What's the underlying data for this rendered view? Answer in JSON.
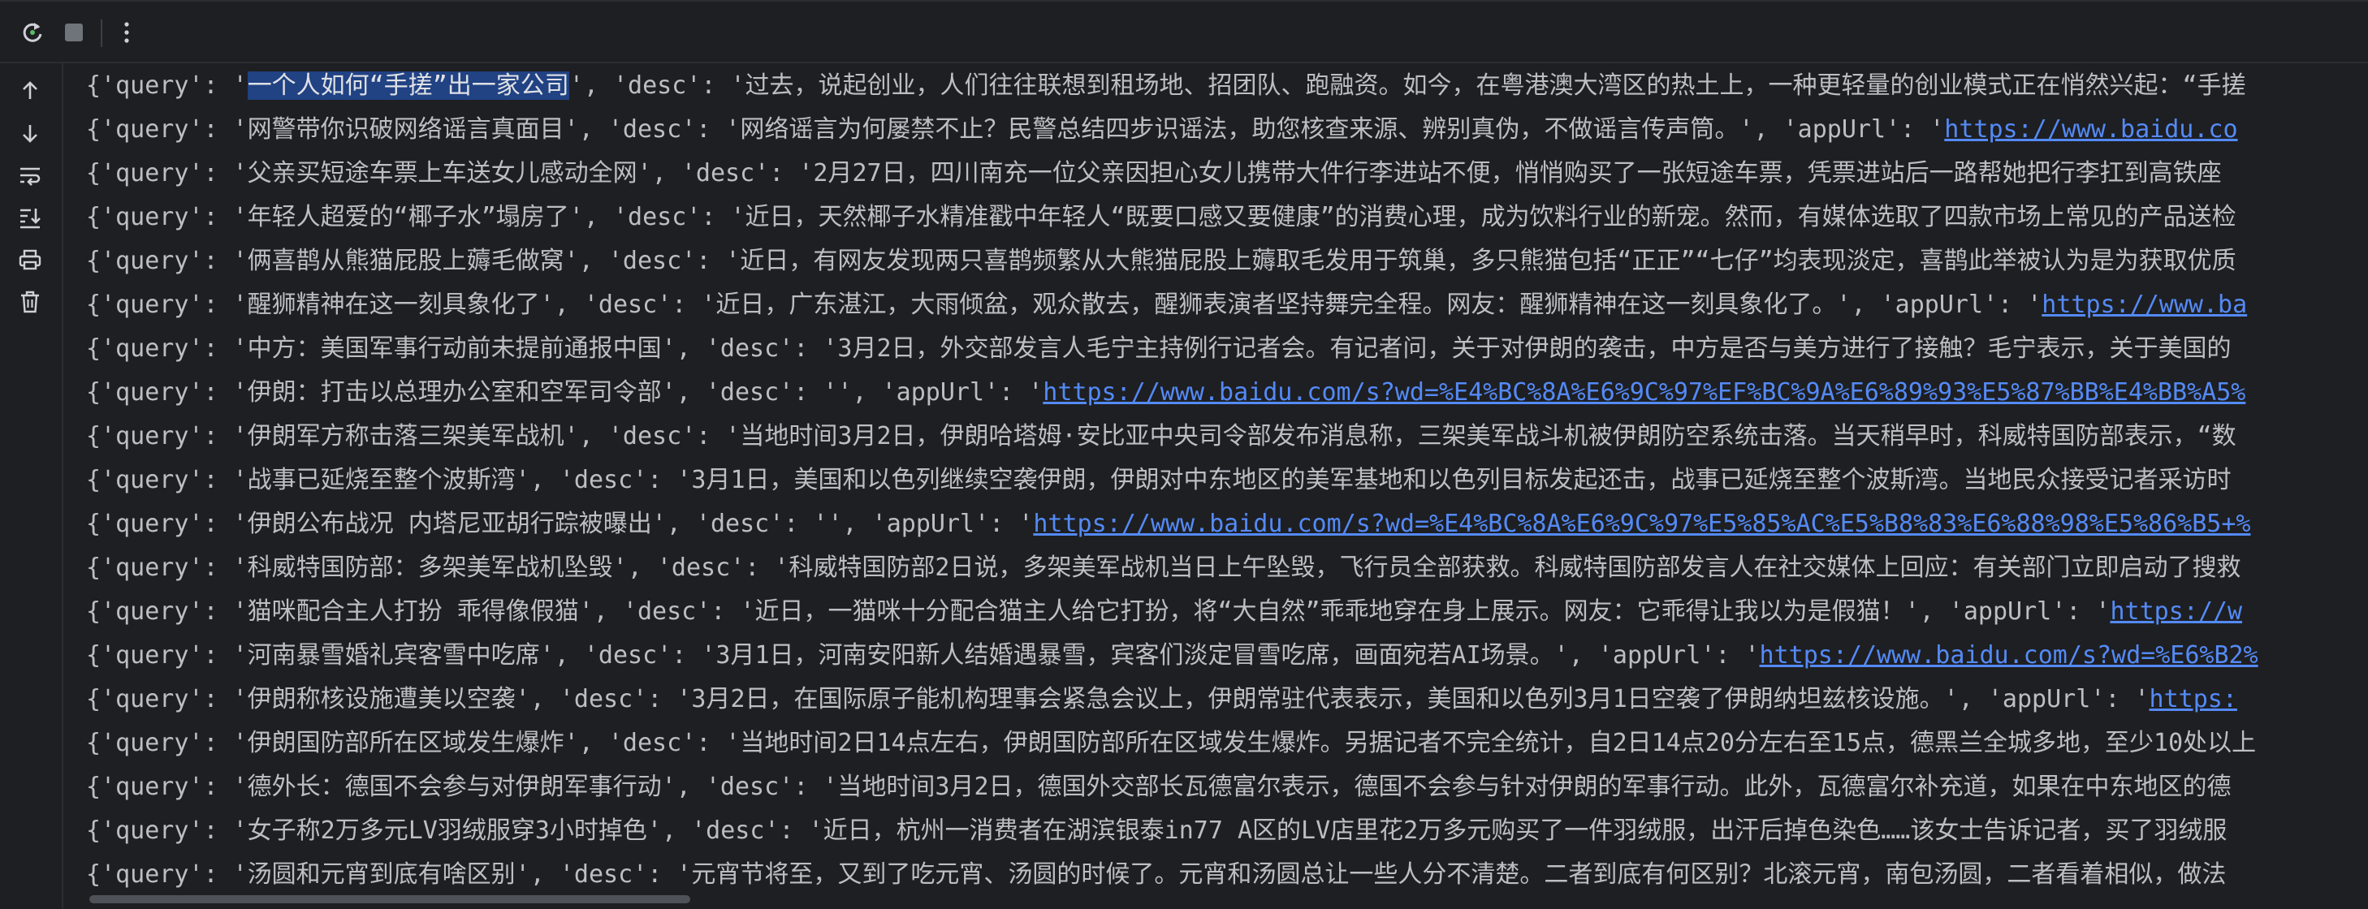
{
  "toolbar": {
    "rerun_icon": "rerun-icon",
    "stop_icon": "stop-icon",
    "more_icon": "more-vertical-icon"
  },
  "gutter": {
    "icons": [
      "arrow-up-icon",
      "arrow-down-icon",
      "soft-wrap-icon",
      "scroll-to-end-icon",
      "print-icon",
      "trash-icon"
    ]
  },
  "console": {
    "lines": [
      {
        "pre": "{'query': '",
        "sel": "一个人如何“手搓”出一家公司",
        "post": "', 'desc': '过去，说起创业，人们往往联想到租场地、招团队、跑融资。如今，在粤港澳大湾区的热土上，一种更轻量的创业模式正在悄然兴起：“手搓",
        "url": ""
      },
      {
        "pre": "{'query': '网警带你识破网络谣言真面目', 'desc': '网络谣言为何屡禁不止？民警总结四步识谣法，助您核查来源、辨别真伪，不做谣言传声筒。', 'appUrl': '",
        "sel": "",
        "post": "",
        "url": "https://www.baidu.co"
      },
      {
        "pre": "{'query': '父亲买短途车票上车送女儿感动全网', 'desc': '2月27日，四川南充一位父亲因担心女儿携带大件行李进站不便，悄悄购买了一张短途车票，凭票进站后一路帮她把行李扛到高铁座",
        "sel": "",
        "post": "",
        "url": ""
      },
      {
        "pre": "{'query': '年轻人超爱的“椰子水”塌房了', 'desc': '近日，天然椰子水精准戳中年轻人“既要口感又要健康”的消费心理，成为饮料行业的新宠。然而，有媒体选取了四款市场上常见的产品送检",
        "sel": "",
        "post": "",
        "url": ""
      },
      {
        "pre": "{'query': '俩喜鹊从熊猫屁股上薅毛做窝', 'desc': '近日，有网友发现两只喜鹊频繁从大熊猫屁股上薅取毛发用于筑巢，多只熊猫包括“正正”“七仔”均表现淡定，喜鹊此举被认为是为获取优质",
        "sel": "",
        "post": "",
        "url": ""
      },
      {
        "pre": "{'query': '醒狮精神在这一刻具象化了', 'desc': '近日，广东湛江，大雨倾盆，观众散去，醒狮表演者坚持舞完全程。网友：醒狮精神在这一刻具象化了。', 'appUrl': '",
        "sel": "",
        "post": "",
        "url": "https://www.ba"
      },
      {
        "pre": "{'query': '中方：美国军事行动前未提前通报中国', 'desc': '3月2日，外交部发言人毛宁主持例行记者会。有记者问，关于对伊朗的袭击，中方是否与美方进行了接触？毛宁表示，关于美国的",
        "sel": "",
        "post": "",
        "url": ""
      },
      {
        "pre": "{'query': '伊朗：打击以总理办公室和空军司令部', 'desc': '', 'appUrl': '",
        "sel": "",
        "post": "",
        "url": "https://www.baidu.com/s?wd=%E4%BC%8A%E6%9C%97%EF%BC%9A%E6%89%93%E5%87%BB%E4%BB%A5%"
      },
      {
        "pre": "{'query': '伊朗军方称击落三架美军战机', 'desc': '当地时间3月2日，伊朗哈塔姆·安比亚中央司令部发布消息称，三架美军战斗机被伊朗防空系统击落。当天稍早时，科威特国防部表示，“数",
        "sel": "",
        "post": "",
        "url": ""
      },
      {
        "pre": "{'query': '战事已延烧至整个波斯湾', 'desc': '3月1日，美国和以色列继续空袭伊朗，伊朗对中东地区的美军基地和以色列目标发起还击，战事已延烧至整个波斯湾。当地民众接受记者采访时",
        "sel": "",
        "post": "",
        "url": ""
      },
      {
        "pre": "{'query': '伊朗公布战况 内塔尼亚胡行踪被曝出', 'desc': '', 'appUrl': '",
        "sel": "",
        "post": "",
        "url": "https://www.baidu.com/s?wd=%E4%BC%8A%E6%9C%97%E5%85%AC%E5%B8%83%E6%88%98%E5%86%B5+%"
      },
      {
        "pre": "{'query': '科威特国防部：多架美军战机坠毁', 'desc': '科威特国防部2日说，多架美军战机当日上午坠毁，飞行员全部获救。科威特国防部发言人在社交媒体上回应：有关部门立即启动了搜救",
        "sel": "",
        "post": "",
        "url": ""
      },
      {
        "pre": "{'query': '猫咪配合主人打扮 乖得像假猫', 'desc': '近日，一猫咪十分配合猫主人给它打扮，将“大自然”乖乖地穿在身上展示。网友：它乖得让我以为是假猫！', 'appUrl': '",
        "sel": "",
        "post": "",
        "url": "https://w"
      },
      {
        "pre": "{'query': '河南暴雪婚礼宾客雪中吃席', 'desc': '3月1日，河南安阳新人结婚遇暴雪，宾客们淡定冒雪吃席，画面宛若AI场景。', 'appUrl': '",
        "sel": "",
        "post": "",
        "url": "https://www.baidu.com/s?wd=%E6%B2%"
      },
      {
        "pre": "{'query': '伊朗称核设施遭美以空袭', 'desc': '3月2日，在国际原子能机构理事会紧急会议上，伊朗常驻代表表示，美国和以色列3月1日空袭了伊朗纳坦兹核设施。', 'appUrl': '",
        "sel": "",
        "post": "",
        "url": "https:"
      },
      {
        "pre": "{'query': '伊朗国防部所在区域发生爆炸', 'desc': '当地时间2日14点左右，伊朗国防部所在区域发生爆炸。另据记者不完全统计，自2日14点20分左右至15点，德黑兰全城多地，至少10处以上",
        "sel": "",
        "post": "",
        "url": ""
      },
      {
        "pre": "{'query': '德外长：德国不会参与对伊朗军事行动', 'desc': '当地时间3月2日，德国外交部长瓦德富尔表示，德国不会参与针对伊朗的军事行动。此外，瓦德富尔补充道，如果在中东地区的德",
        "sel": "",
        "post": "",
        "url": ""
      },
      {
        "pre": "{'query': '女子称2万多元LV羽绒服穿3小时掉色', 'desc': '近日，杭州一消费者在湖滨银泰in77 A区的LV店里花2万多元购买了一件羽绒服，出汗后掉色染色……该女士告诉记者，买了羽绒服",
        "sel": "",
        "post": "",
        "url": ""
      },
      {
        "pre": "{'query': '汤圆和元宵到底有啥区别', 'desc': '元宵节将至，又到了吃元宵、汤圆的时候了。元宵和汤圆总让一些人分不清楚。二者到底有何区别？北滚元宵，南包汤圆，二者看着相似，做法",
        "sel": "",
        "post": "",
        "url": ""
      }
    ]
  },
  "colors": {
    "background": "#1e1f22",
    "text": "#bcbec4",
    "link": "#548af7",
    "selection": "#214283",
    "border": "#2b2d30"
  }
}
